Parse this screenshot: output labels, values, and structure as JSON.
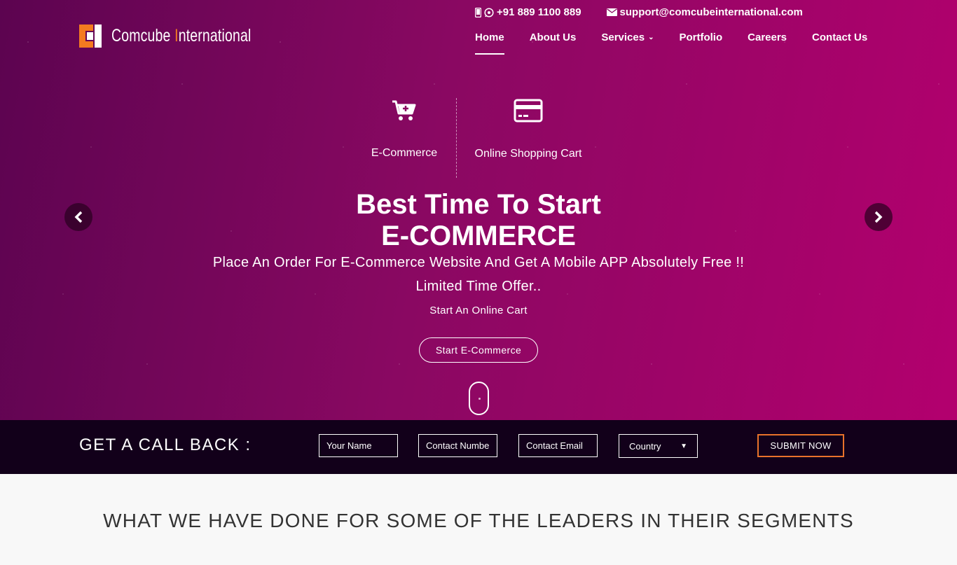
{
  "brand": {
    "name_prefix": "Comcube ",
    "name_accent": "I",
    "name_suffix": "nternational",
    "accent_color": "#f47b20"
  },
  "contact": {
    "phone": "+91 889 1100 889",
    "email": "support@comcubeinternational.com"
  },
  "nav": [
    {
      "label": "Home",
      "active": true
    },
    {
      "label": "About Us"
    },
    {
      "label": "Services",
      "has_dropdown": true
    },
    {
      "label": "Portfolio"
    },
    {
      "label": "Careers"
    },
    {
      "label": "Contact Us"
    }
  ],
  "features": [
    {
      "label": "E-Commerce",
      "icon": "cart-plus-icon"
    },
    {
      "label": "Online Shopping Cart",
      "icon": "credit-card-icon"
    }
  ],
  "hero": {
    "headline_line1": "Best Time To Start",
    "headline_line2": "E-COMMERCE",
    "subtitle1": "Place An Order For E-Commerce Website And Get A Mobile APP Absolutely Free !!",
    "subtitle2": "Limited Time Offer..",
    "subtitle3": "Start An Online Cart",
    "cta_label": "Start E-Commerce"
  },
  "callback": {
    "title": "GET A CALL BACK :",
    "name_placeholder": "Your Name",
    "contact_placeholder": "Contact Number",
    "email_placeholder": "Contact Email",
    "country_label": "Country",
    "submit_label": "SUBMIT NOW"
  },
  "section": {
    "title": "WHAT WE HAVE DONE FOR SOME OF THE LEADERS IN THEIR SEGMENTS"
  }
}
